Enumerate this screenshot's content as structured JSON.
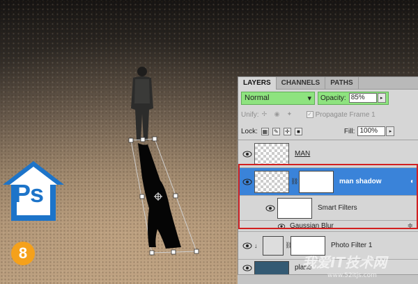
{
  "panel": {
    "tabs": [
      {
        "label": "LAYERS"
      },
      {
        "label": "CHANNELS"
      },
      {
        "label": "PATHS"
      }
    ],
    "blend_mode": "Normal",
    "opacity_label": "Opacity:",
    "opacity_value": "85%",
    "unify_label": "Unify:",
    "propagate_label": "Propagate Frame 1",
    "lock_label": "Lock:",
    "fill_label": "Fill:",
    "fill_value": "100%",
    "layers": [
      {
        "name": "MAN"
      },
      {
        "name": "man shadow"
      },
      {
        "name": "Smart Filters"
      },
      {
        "name": "Gaussian Blur"
      },
      {
        "name": "Photo Filter 1"
      },
      {
        "name": "plane"
      }
    ]
  },
  "step_number": "8",
  "logo_text": "Ps",
  "watermark": {
    "text": "我爱IT技术网",
    "url": "www.52itjs.com"
  },
  "colors": {
    "highlight_green": "#8ee37f",
    "selected_blue": "#3a83d9",
    "annotation_red": "#d21f1f",
    "badge_orange": "#f5a11b",
    "logo_blue": "#1d74c9"
  }
}
